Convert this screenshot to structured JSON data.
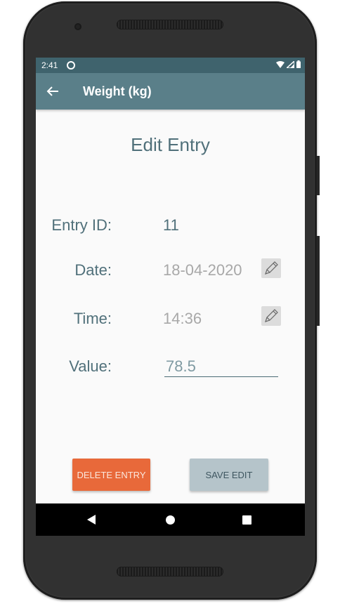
{
  "status_bar": {
    "time": "2:41"
  },
  "app_bar": {
    "title": "Weight (kg)"
  },
  "form": {
    "heading": "Edit Entry",
    "entry_id_label": "Entry ID:",
    "entry_id_value": "11",
    "date_label": "Date:",
    "date_value": "18-04-2020",
    "time_label": "Time:",
    "time_value": "14:36",
    "value_label": "Value:",
    "value_input": "78.5"
  },
  "actions": {
    "delete_label": "DELETE ENTRY",
    "save_label": "SAVE EDIT"
  },
  "colors": {
    "app_bar": "#5a7f89",
    "status_bar": "#3f636d",
    "delete_button": "#e8693a",
    "save_button": "#b5c4ca",
    "text_primary": "#50707a"
  }
}
